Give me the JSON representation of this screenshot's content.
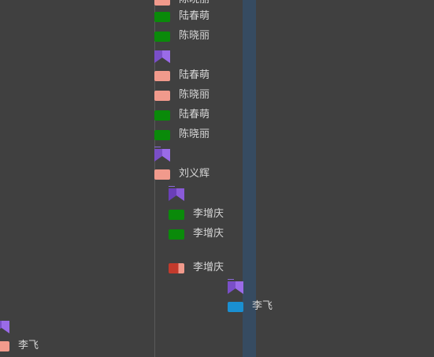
{
  "colors": {
    "background": "#404040",
    "green": "#0a8a0a",
    "pink": "#f19a8c",
    "purple": "#7a4fc8",
    "blue": "#1a8fd1",
    "red": "#c23a2c",
    "lane": "#364b61"
  },
  "rows": [
    {
      "label": "陈晓丽",
      "chip": "pink"
    },
    {
      "label": "陆春萌",
      "chip": "green"
    },
    {
      "label": "陈晓丽",
      "chip": "green"
    },
    {
      "label": "陆春萌",
      "chip": "pink"
    },
    {
      "label": "陈晓丽",
      "chip": "pink"
    },
    {
      "label": "陆春萌",
      "chip": "green"
    },
    {
      "label": "陈晓丽",
      "chip": "green"
    },
    {
      "label": "刘义辉",
      "chip": "pink"
    },
    {
      "label": "李增庆",
      "chip": "green"
    },
    {
      "label": "李增庆",
      "chip": "green"
    },
    {
      "label": "李增庆",
      "chip": "red"
    },
    {
      "label": "李飞",
      "chip": "blue"
    },
    {
      "label": "李飞",
      "chip": "pink"
    }
  ],
  "flags": [
    {
      "icon": "bookmark-flag-icon"
    },
    {
      "icon": "bookmark-flag-icon"
    },
    {
      "icon": "bookmark-flag-icon"
    },
    {
      "icon": "bookmark-flag-icon"
    },
    {
      "icon": "bookmark-flag-icon"
    }
  ]
}
